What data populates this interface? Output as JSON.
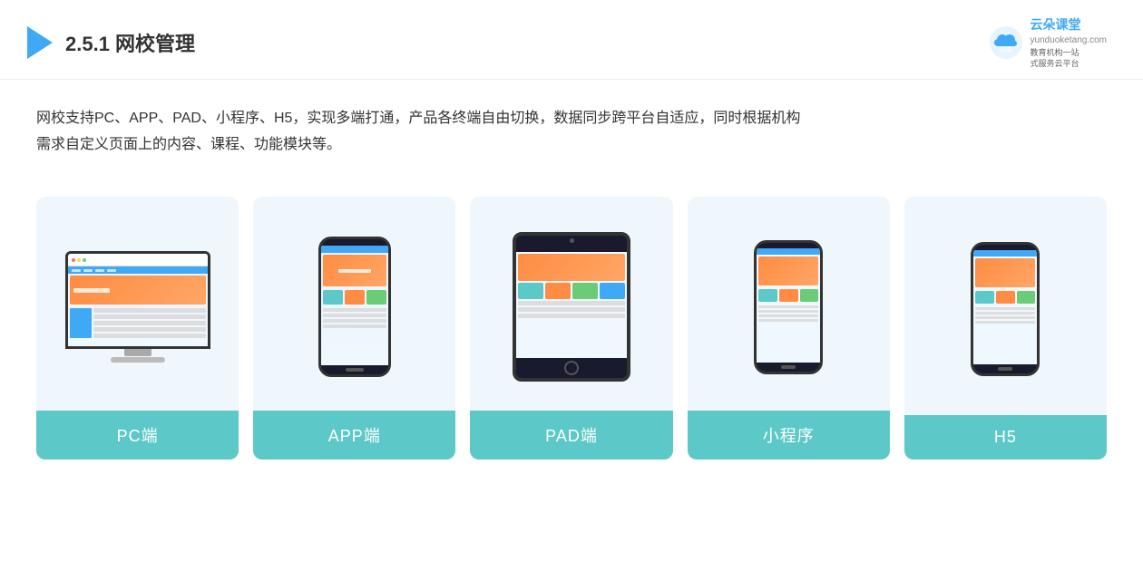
{
  "header": {
    "title_prefix": "2.5.1 ",
    "title_bold": "网校管理",
    "brand_name": "云朵课堂",
    "brand_url": "yunduoketang.com",
    "brand_tagline": "教育机构一站\n式服务云平台"
  },
  "description": {
    "text_line1": "网校支持PC、APP、PAD、小程序、H5，实现多端打通，产品各终端自由切换，数据同步跨平台自适应，同时根据机构",
    "text_line2": "需求自定义页面上的内容、课程、功能模块等。"
  },
  "cards": [
    {
      "id": "pc",
      "label": "PC端"
    },
    {
      "id": "app",
      "label": "APP端"
    },
    {
      "id": "pad",
      "label": "PAD端"
    },
    {
      "id": "miniapp",
      "label": "小程序"
    },
    {
      "id": "h5",
      "label": "H5"
    }
  ]
}
